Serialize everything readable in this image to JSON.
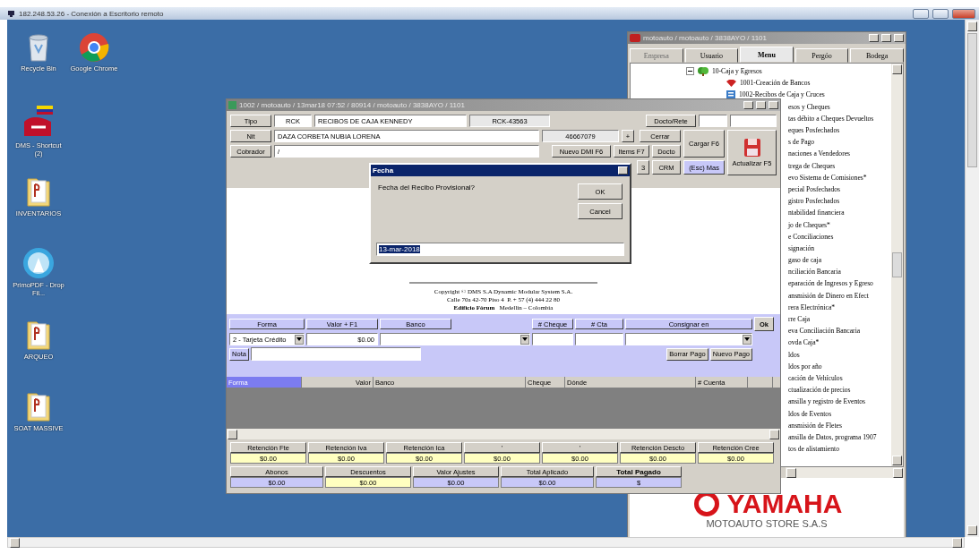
{
  "remote_title": "182.248.53.26 - Conexión a Escritorio remoto",
  "desktop_icons": [
    {
      "label": "Recycle Bin",
      "kind": "bin"
    },
    {
      "label": "Google Chrome",
      "kind": "chrome"
    },
    {
      "label": "DMS - Shortcut (2)",
      "kind": "dms"
    },
    {
      "label": "INVENTARIOS",
      "kind": "folder"
    },
    {
      "label": "PrimoPDF - Drop Fil...",
      "kind": "primo"
    },
    {
      "label": "ARQUEO",
      "kind": "folder"
    },
    {
      "label": "SOAT MASSIVE",
      "kind": "folder"
    }
  ],
  "menu_window": {
    "title": "motoauto / motoauto / 3838AYO / 1101",
    "tabs": [
      {
        "label": "Empresa",
        "selected": false,
        "disabled": true
      },
      {
        "label": "Usuario",
        "selected": false,
        "disabled": false
      },
      {
        "label": "Menu",
        "selected": true,
        "disabled": false
      },
      {
        "label": "Pergóo",
        "selected": false,
        "disabled": false
      },
      {
        "label": "Bodega",
        "selected": false,
        "disabled": false
      }
    ],
    "tree": [
      {
        "label": "10-Caja y Egresos",
        "kind": "group",
        "expanded": true,
        "children": [
          {
            "label": "1001-Creación de Bancos",
            "kind": "bank"
          },
          {
            "label": "1002-Recibos de Caja y Cruces",
            "kind": "receipt"
          },
          {
            "label": "esos y Cheques",
            "kind": "clipped"
          },
          {
            "label": "tas débito a Cheques Devueltos",
            "kind": "clipped"
          },
          {
            "label": "eques Posfechados",
            "kind": "clipped"
          },
          {
            "label": "s de Pago",
            "kind": "clipped"
          },
          {
            "label": "naciones a Vendedores",
            "kind": "clipped"
          },
          {
            "label": "trega de Cheques",
            "kind": "clipped"
          },
          {
            "label": "evo Sistema de Comisiones*",
            "kind": "clipped"
          },
          {
            "label": "pecial Posfechados",
            "kind": "clipped"
          },
          {
            "label": "gistro Posfechados",
            "kind": "clipped"
          },
          {
            "label": "ntabilidad financiera",
            "kind": "clipped"
          },
          {
            "label": "jo de Cheques*",
            "kind": "clipped"
          },
          {
            "label": "e Conciliaciones",
            "kind": "clipped"
          },
          {
            "label": "signación",
            "kind": "clipped"
          },
          {
            "label": "gaso de caja",
            "kind": "clipped"
          },
          {
            "label": "nciliación Bancaria",
            "kind": "clipped"
          },
          {
            "label": "eparación de Ingresos y Egreso",
            "kind": "clipped"
          },
          {
            "label": "ansmisión de Dinero en Efect",
            "kind": "clipped"
          },
          {
            "label": "rera Electrónica*",
            "kind": "clipped"
          },
          {
            "label": "rre Caja",
            "kind": "clipped"
          },
          {
            "label": "eva Conciliación Bancaria",
            "kind": "clipped"
          },
          {
            "label": "ovda Caja*",
            "kind": "clipped"
          },
          {
            "label": "ldos",
            "kind": "clipped"
          },
          {
            "label": "ldos por año",
            "kind": "clipped"
          },
          {
            "label": "cación de Vehículos",
            "kind": "clipped"
          },
          {
            "label": "ctualización de precios",
            "kind": "clipped"
          },
          {
            "label": "ansilla y registro de Eventos",
            "kind": "clipped"
          },
          {
            "label": "ldos de Eventos",
            "kind": "clipped"
          },
          {
            "label": "ansmisión de Fletes",
            "kind": "clipped"
          },
          {
            "label": "ansilla de Datos, programa 1907",
            "kind": "clipped"
          },
          {
            "label": "tos de alistamiento",
            "kind": "clipped"
          }
        ]
      }
    ],
    "brand": "YAMAHA",
    "company": "MOTOAUTO STORE S.A.S"
  },
  "main_window": {
    "title": "1002 / motoauto / 13mar18 07:52 / 80914 / motoauto / 3838AYO / 1101",
    "header": {
      "tipo_label": "Tipo",
      "tipo_code": "RCK",
      "tipo_name": "RECIBOS DE CAJA KENNEDY",
      "document": "RCK-43563",
      "docto_rete_label": "Docto/Rete",
      "nit_label": "Nit",
      "nit_name": "DAZA CORBETA NUBIA LORENA",
      "nit_number": "46667079",
      "cobrador_label": "Cobrador",
      "cobrador_value": "/"
    },
    "buttons": {
      "plus": "+",
      "cerrar": "Cerrar",
      "cargar": "Cargar F6",
      "nuevo_dmi": "Nuevo DMI F6",
      "items": "Items F7",
      "docto": "Docto",
      "three": "3",
      "crm": "CRM",
      "esc_mas": "(Esc) Mas",
      "actualizar": "Actualizar F5"
    },
    "copyright": [
      "Copyright © DMS S.A Dynamic Modular System S.A.",
      "Calle 70a 42-70 Piso 4  P. + 57 (4) 444 22 80",
      "**Edificio Fórum**   Medellín – Colombia"
    ],
    "payment": {
      "headers": [
        "Forma",
        "Valor + F1",
        "Banco",
        "# Cheque",
        "# Cta",
        "Consignar en"
      ],
      "ok": "Ok",
      "forma_value": "2 - Tarjeta Crédito",
      "valor_value": "$0.00",
      "nota_label": "Nota",
      "buttons": [
        "Borrar Pago",
        "Nuevo Pago"
      ]
    },
    "grid_columns": [
      {
        "label": "Forma",
        "selected": true
      },
      {
        "label": "Valor",
        "selected": false
      },
      {
        "label": "Banco",
        "selected": false
      },
      {
        "label": "Cheque",
        "selected": false
      },
      {
        "label": "Dónde",
        "selected": false
      },
      {
        "label": "# Cuenta",
        "selected": false
      }
    ],
    "retentions": [
      {
        "label": "Retención Fte",
        "value": "$0.00",
        "color": "#ffffc0"
      },
      {
        "label": "Retención Iva",
        "value": "$0.00",
        "color": "#ffffc0"
      },
      {
        "label": "Retención Ica",
        "value": "$0.00",
        "color": "#ffffc0"
      },
      {
        "label": "'",
        "value": "$0.00",
        "color": "#ffffc0"
      },
      {
        "label": "'",
        "value": "$0.00",
        "color": "#ffffc0"
      },
      {
        "label": "Retención Descto",
        "value": "$0.00",
        "color": "#ffffc0"
      },
      {
        "label": "Retención Cree",
        "value": "$0.00",
        "color": "#ffffc0"
      }
    ],
    "totals": [
      {
        "label": "Abonos",
        "value": "$0.00",
        "color": "#c8c8f8"
      },
      {
        "label": "Descuentos",
        "value": "$0.00",
        "color": "#ffffc0"
      },
      {
        "label": "Valor Ajustes",
        "value": "$0.00",
        "color": "#c8c8f8"
      },
      {
        "label": "Total Aplicado",
        "value": "$0.00",
        "color": "#c8c8f8"
      },
      {
        "label": "Total Pagado",
        "value": "$",
        "color": "#c8c8f8"
      }
    ]
  },
  "dialog": {
    "title": "Fecha",
    "message": "Fecha del Recibo Provisional?",
    "buttons": [
      "OK",
      "Cancel"
    ],
    "input": {
      "value": "13-mar-2018",
      "selected": true
    }
  }
}
